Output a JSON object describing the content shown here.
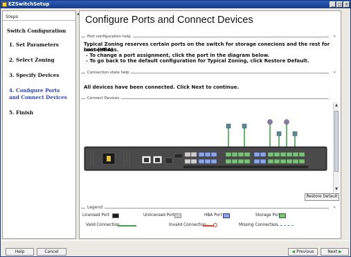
{
  "window": {
    "title": "EZSwitchSetup",
    "controls": {
      "minimize": "_",
      "maximize": "□",
      "close": "×"
    }
  },
  "sidebar": {
    "label": "Steps",
    "collapse_glyph": "◂",
    "items": [
      {
        "label": "Switch Configuration",
        "active": false
      },
      {
        "label": "1. Set Parameters",
        "active": false
      },
      {
        "label": "2. Select Zoning",
        "active": false
      },
      {
        "label": "3. Specify Devices",
        "active": false
      },
      {
        "label": "4. Configure Ports",
        "active": true
      },
      {
        "label": "and Connect Devices",
        "active": true
      },
      {
        "label": "5. Finish",
        "active": false
      }
    ]
  },
  "main": {
    "title": "Configure Ports and Connect Devices",
    "port_help": {
      "header": "Port configuration help",
      "toggle": "«",
      "lines": [
        "Typical Zoning reserves certain ports on the switch for storage conecions and the rest for host (HBA)",
        "connections.",
        "- To change a port assignment, click the port in the diagram below.",
        "- To go back to the default configuration for Typical Zoning, click Restore Default."
      ]
    },
    "state_help": {
      "header": "Connection state help",
      "toggle": "«",
      "message": "All devices have been connected. Click Next to continue."
    },
    "connect_devices": {
      "header": "Connect Devices"
    },
    "restore_button": "Restore Default",
    "legend": {
      "header": "Legend",
      "toggle": "«",
      "items": [
        {
          "label": "Licensed Port"
        },
        {
          "label": "Unlicensed Port"
        },
        {
          "label": "HBA Port"
        },
        {
          "label": "Storage Port"
        },
        {
          "label": "Valid Connection",
          "color": "#3aa84a"
        },
        {
          "label": "Invalid Connection",
          "color": "#e04020"
        },
        {
          "label": "Missing Connection",
          "color": "#5080d0"
        }
      ]
    }
  },
  "buttons": {
    "help": "Help",
    "cancel": "Cancel",
    "previous": "Previous",
    "next": "Next"
  },
  "colors": {
    "title_bar": "#1f4ea3",
    "active_step": "#2a44c8",
    "switch_body": "#3a3a3a",
    "port_hba": "#8ea6e8",
    "port_storage": "#7cc07c",
    "valid_connection": "#3aa84a"
  }
}
